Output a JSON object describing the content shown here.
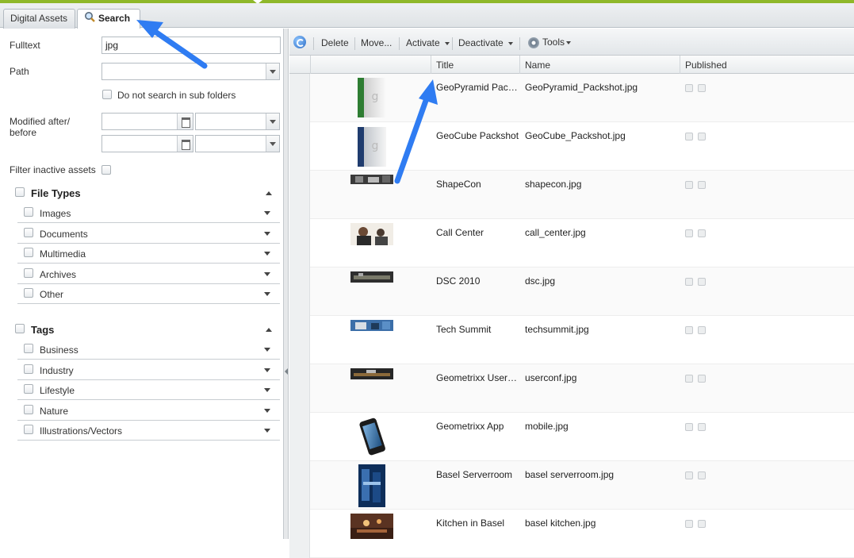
{
  "tabs": [
    {
      "label": "Digital Assets",
      "active": false
    },
    {
      "label": "Search",
      "active": true,
      "icon": "search-icon"
    }
  ],
  "filters": {
    "fulltext_label": "Fulltext",
    "fulltext_value": "jpg",
    "path_label": "Path",
    "path_value": "",
    "subfolders_label": "Do not search in sub folders",
    "modified_label_1": "Modified after/",
    "modified_label_2": "before",
    "inactive_label": "Filter inactive assets"
  },
  "file_types": {
    "title": "File Types",
    "items": [
      "Images",
      "Documents",
      "Multimedia",
      "Archives",
      "Other"
    ]
  },
  "tags": {
    "title": "Tags",
    "items": [
      "Business",
      "Industry",
      "Lifestyle",
      "Nature",
      "Illustrations/Vectors"
    ]
  },
  "toolbar": {
    "delete": "Delete",
    "move": "Move...",
    "activate": "Activate",
    "deactivate": "Deactivate",
    "tools": "Tools"
  },
  "columns": {
    "title": "Title",
    "name": "Name",
    "published": "Published"
  },
  "rows": [
    {
      "title": "GeoPyramid Pack…",
      "name": "GeoPyramid_Packshot.jpg",
      "thumb": "green-box-thumbnail"
    },
    {
      "title": "GeoCube Packshot",
      "name": "GeoCube_Packshot.jpg",
      "thumb": "blue-box-thumbnail"
    },
    {
      "title": "ShapeCon",
      "name": "shapecon.jpg",
      "thumb": "photo-thumbnail"
    },
    {
      "title": "Call Center",
      "name": "call_center.jpg",
      "thumb": "photo-thumbnail"
    },
    {
      "title": "DSC 2010",
      "name": "dsc.jpg",
      "thumb": "photo-thumbnail"
    },
    {
      "title": "Tech Summit",
      "name": "techsummit.jpg",
      "thumb": "photo-thumbnail"
    },
    {
      "title": "Geometrixx User …",
      "name": "userconf.jpg",
      "thumb": "photo-thumbnail"
    },
    {
      "title": "Geometrixx App",
      "name": "mobile.jpg",
      "thumb": "phone-thumbnail"
    },
    {
      "title": "Basel Serverroom",
      "name": "basel serverroom.jpg",
      "thumb": "photo-thumbnail"
    },
    {
      "title": "Kitchen in Basel",
      "name": "basel kitchen.jpg",
      "thumb": "photo-thumbnail"
    }
  ],
  "colors": {
    "accent": "#8fb82a",
    "annotation_arrow": "#2f7cf2"
  }
}
